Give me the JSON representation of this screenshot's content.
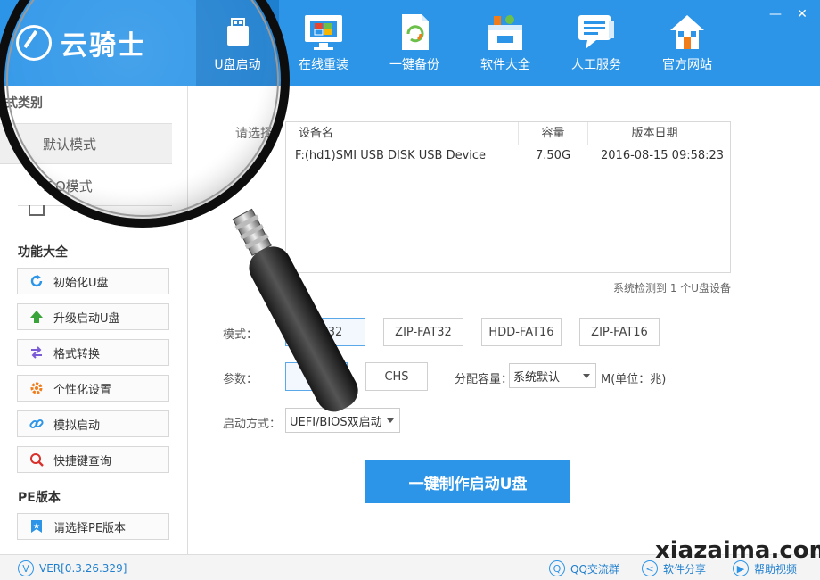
{
  "app": {
    "logo_text": "云骑士"
  },
  "nav": [
    {
      "label": "U盘启动",
      "icon": "usb-icon",
      "active": true
    },
    {
      "label": "在线重装",
      "icon": "monitor-windows-icon"
    },
    {
      "label": "一键备份",
      "icon": "backup-icon"
    },
    {
      "label": "软件大全",
      "icon": "software-box-icon"
    },
    {
      "label": "人工服务",
      "icon": "chat-icon"
    },
    {
      "label": "官方网站",
      "icon": "home-icon"
    }
  ],
  "window": {
    "minimize": "—",
    "close": "✕"
  },
  "sidebar": {
    "mode_title": "式类别",
    "modes": [
      {
        "label": "默认模式",
        "selected": true
      },
      {
        "label": "ISO模式"
      }
    ],
    "func_title": "功能大全",
    "functions": [
      {
        "label": "初始化U盘",
        "icon": "refresh-icon",
        "color": "#2c95e8"
      },
      {
        "label": "升级启动U盘",
        "icon": "arrow-up-icon",
        "color": "#3aa33a"
      },
      {
        "label": "格式转换",
        "icon": "swap-icon",
        "color": "#7a5bd6"
      },
      {
        "label": "个性化设置",
        "icon": "gear-icon",
        "color": "#f07d1a"
      },
      {
        "label": "模拟启动",
        "icon": "link-icon",
        "color": "#2c95e8"
      },
      {
        "label": "快捷键查询",
        "icon": "search-icon",
        "color": "#d9302c"
      }
    ],
    "pe_title": "PE版本",
    "pe_button": {
      "label": "请选择PE版本",
      "icon": "bookmark-icon",
      "color": "#2c95e8"
    }
  },
  "main": {
    "select_label": "请选择",
    "table": {
      "headers": [
        "设备名",
        "容量",
        "版本日期"
      ],
      "rows": [
        [
          "F:(hd1)SMI USB DISK USB Device",
          "7.50G",
          "2016-08-15 09:58:23"
        ]
      ]
    },
    "detected_text": "系统检测到 1 个U盘设备",
    "mode_label": "模式：",
    "mode_options": [
      "FAT32",
      "ZIP-FAT32",
      "HDD-FAT16",
      "ZIP-FAT16"
    ],
    "param_label": "参数：",
    "param_options": [
      "N",
      "CHS"
    ],
    "alloc_label": "分配容量：",
    "alloc_value": "系统默认",
    "alloc_unit": "M(单位：兆)",
    "boot_label": "启动方式：",
    "boot_value": "UEFI/BIOS双启动",
    "make_button": "一键制作启动U盘"
  },
  "status": {
    "version": "VER[0.3.26.329]",
    "qq_group": "QQ交流群",
    "share": "软件分享",
    "help_video": "帮助视频"
  },
  "watermark": "xiazaima.com"
}
